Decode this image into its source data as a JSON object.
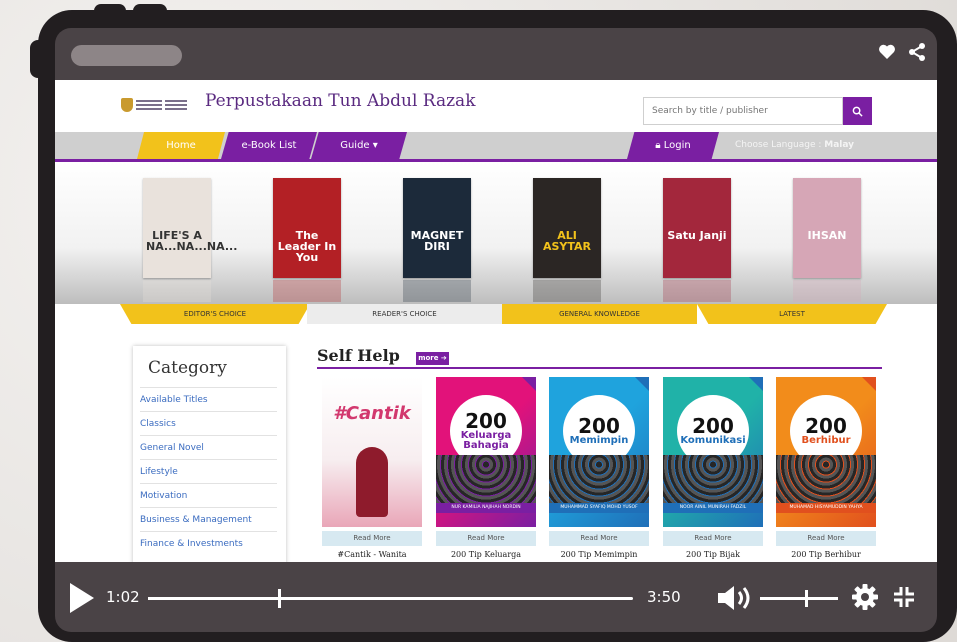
{
  "player": {
    "current_time": "1:02",
    "duration": "3:50",
    "progress_fraction": 0.27,
    "volume_fraction": 0.58
  },
  "site": {
    "title": "Perpustakaan Tun Abdul Razak",
    "search_placeholder": "Search by title / publisher"
  },
  "nav": {
    "home": "Home",
    "ebook_list": "e-Book List",
    "guide": "Guide ▾",
    "login": "Login",
    "language_label": "Choose Language : ",
    "language_value": "Malay"
  },
  "featured_books": [
    {
      "title": "LIFE'S A NA...NA...NA...",
      "cover_color": "#e9e2dc",
      "text_color": "#333333"
    },
    {
      "title": "The Leader In You",
      "cover_color": "#b32025",
      "text_color": "#ffffff"
    },
    {
      "title": "MAGNET DIRI",
      "cover_color": "#1c2a3a",
      "text_color": "#ffffff"
    },
    {
      "title": "ALI ASYTAR",
      "cover_color": "#2b2624",
      "text_color": "#f2c21b"
    },
    {
      "title": "Satu Janji",
      "cover_color": "#a3273c",
      "text_color": "#ffffff"
    },
    {
      "title": "IHSAN",
      "cover_color": "#d6a6b6",
      "text_color": "#ffffff"
    }
  ],
  "tabs": [
    "EDITOR'S CHOICE",
    "READER'S CHOICE",
    "GENERAL KNOWLEDGE",
    "LATEST"
  ],
  "category": {
    "heading": "Category",
    "items": [
      "Available Titles",
      "Classics",
      "General Novel",
      "Lifestyle",
      "Motivation",
      "Business & Management",
      "Finance & Investments"
    ]
  },
  "section": {
    "title": "Self Help",
    "more_label": "more ➔",
    "read_more_label": "Read More",
    "books": [
      {
        "title": "#Cantik - Wanita",
        "cover_top": "#ffffff",
        "accent": "#d2386e",
        "ring_text": "#Cantik"
      },
      {
        "title": "200 Tip Keluarga",
        "cover_top": "#e2127a",
        "accent": "#7a1fa2",
        "ring_number": "200",
        "ring_text": "Keluarga Bahagia"
      },
      {
        "title": "200 Tip Memimpin",
        "cover_top": "#1fa3dd",
        "accent": "#1f6fb8",
        "ring_number": "200",
        "ring_text": "Memimpin"
      },
      {
        "title": "200 Tip Bijak",
        "cover_top": "#20b2a8",
        "accent": "#1f6fb8",
        "ring_number": "200",
        "ring_text": "Komunikasi"
      },
      {
        "title": "200 Tip Berhibur",
        "cover_top": "#f28c1b",
        "accent": "#e1501e",
        "ring_number": "200",
        "ring_text": "Berhibur"
      }
    ],
    "book_authors": [
      "",
      "NUR KAMILIA NAJIHAH NORDIN",
      "MUHAMMAD SYAFIQ MOHD YUSOF",
      "NOOR AINIL MUNIRAH FADZIL",
      "MUHAMAD HISYAMUDDIN YAHYA"
    ]
  }
}
